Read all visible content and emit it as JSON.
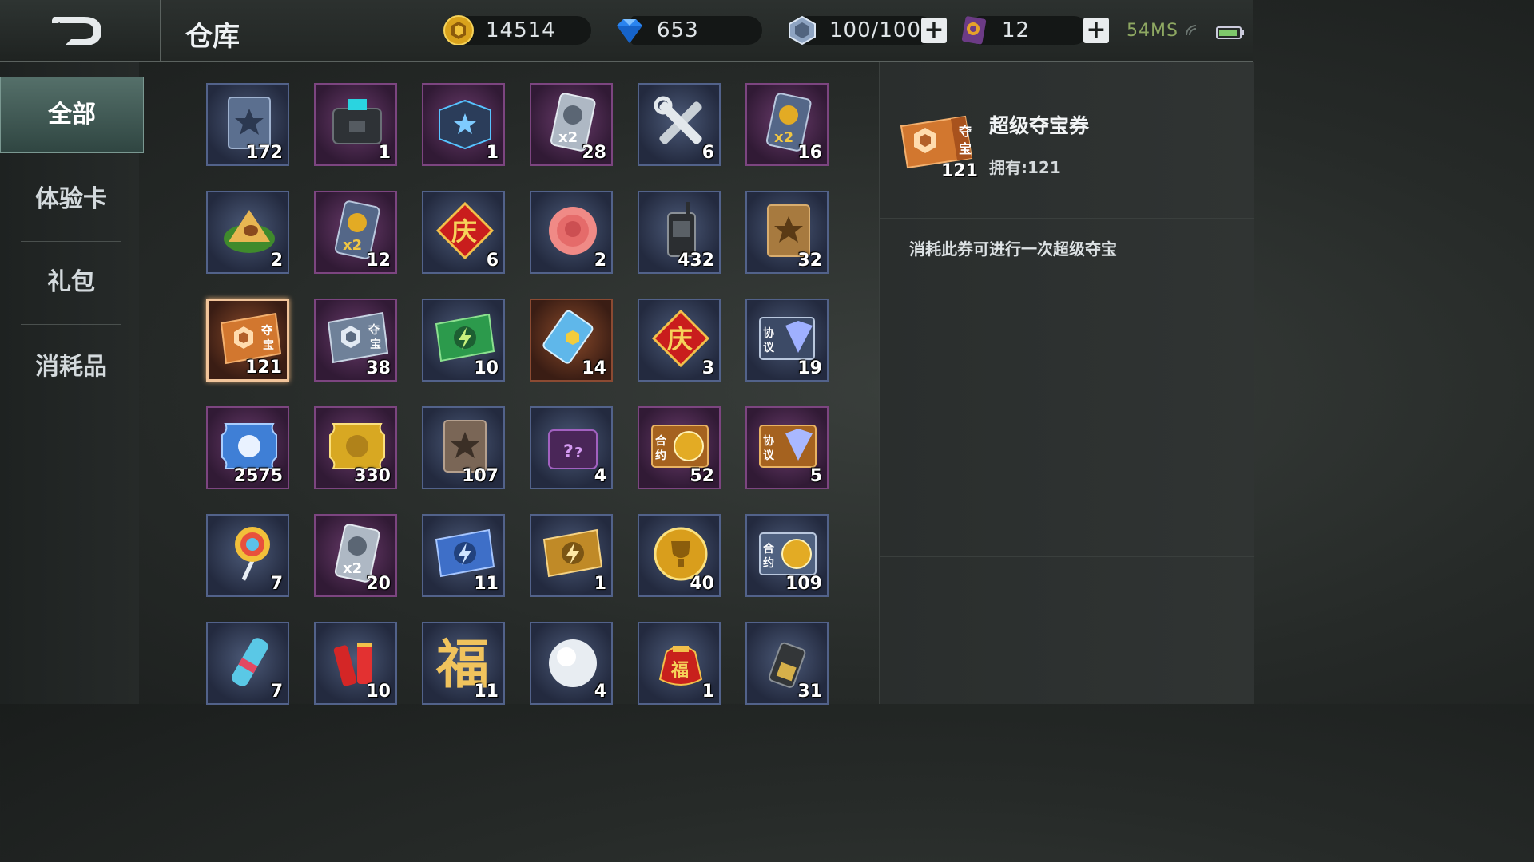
{
  "header": {
    "title": "仓库",
    "gold": "14514",
    "diamond": "653",
    "energy": "100/100",
    "ticket": "12",
    "network": "54MS",
    "plus": "+"
  },
  "sidebar": {
    "tabs": [
      {
        "label": "全部",
        "active": true
      },
      {
        "label": "体验卡",
        "active": false
      },
      {
        "label": "礼包",
        "active": false
      },
      {
        "label": "消耗品",
        "active": false
      }
    ]
  },
  "inventory": [
    {
      "name": "blue-book-icon",
      "qty": "172",
      "frame": "blue"
    },
    {
      "name": "black-chest-icon",
      "qty": "1",
      "frame": "purple"
    },
    {
      "name": "blue-box-icon",
      "qty": "1",
      "frame": "purple"
    },
    {
      "name": "silver-x2-card-icon",
      "qty": "28",
      "frame": "purple"
    },
    {
      "name": "wrench-tools-icon",
      "qty": "6",
      "frame": "blue"
    },
    {
      "name": "gold-x2-card-icon",
      "qty": "16",
      "frame": "purple"
    },
    {
      "name": "rice-dumpling-icon",
      "qty": "2",
      "frame": "blue"
    },
    {
      "name": "gold-x2-card-icon",
      "qty": "12",
      "frame": "purple"
    },
    {
      "name": "celebration-tile-icon",
      "qty": "6",
      "frame": "blue"
    },
    {
      "name": "rose-icon",
      "qty": "2",
      "frame": "blue"
    },
    {
      "name": "walkie-talkie-icon",
      "qty": "432",
      "frame": "blue"
    },
    {
      "name": "bronze-book-icon",
      "qty": "32",
      "frame": "blue"
    },
    {
      "name": "super-treasure-ticket-icon",
      "qty": "121",
      "frame": "orange",
      "selected": true
    },
    {
      "name": "silver-treasure-ticket-icon",
      "qty": "38",
      "frame": "purple"
    },
    {
      "name": "green-lightning-card-icon",
      "qty": "10",
      "frame": "blue"
    },
    {
      "name": "blue-chip-card-icon",
      "qty": "14",
      "frame": "orange"
    },
    {
      "name": "celebration-tile-icon",
      "qty": "3",
      "frame": "blue"
    },
    {
      "name": "diamond-agreement-icon",
      "qty": "19",
      "frame": "blue"
    },
    {
      "name": "blue-coupon-icon",
      "qty": "2575",
      "frame": "purple"
    },
    {
      "name": "gold-coupon-icon",
      "qty": "330",
      "frame": "purple"
    },
    {
      "name": "brown-book-icon",
      "qty": "107",
      "frame": "blue"
    },
    {
      "name": "purple-mystery-chest-icon",
      "qty": "4",
      "frame": "blue"
    },
    {
      "name": "gold-contract-card-icon",
      "qty": "52",
      "frame": "purple"
    },
    {
      "name": "gold-diamond-agreement-icon",
      "qty": "5",
      "frame": "purple"
    },
    {
      "name": "lollipop-icon",
      "qty": "7",
      "frame": "blue"
    },
    {
      "name": "silver-x2-card-icon",
      "qty": "20",
      "frame": "purple"
    },
    {
      "name": "blue-lightning-card-icon",
      "qty": "11",
      "frame": "blue"
    },
    {
      "name": "gold-lightning-card-icon",
      "qty": "1",
      "frame": "blue"
    },
    {
      "name": "gold-trophy-coin-icon",
      "qty": "40",
      "frame": "blue"
    },
    {
      "name": "contract-card-icon",
      "qty": "109",
      "frame": "blue"
    },
    {
      "name": "spray-canister-icon",
      "qty": "7",
      "frame": "blue"
    },
    {
      "name": "firecracker-icon",
      "qty": "10",
      "frame": "blue"
    },
    {
      "name": "fortune-character-icon",
      "qty": "11",
      "frame": "blue"
    },
    {
      "name": "snowball-icon",
      "qty": "4",
      "frame": "blue"
    },
    {
      "name": "lucky-bag-icon",
      "qty": "1",
      "frame": "blue"
    },
    {
      "name": "gold-walkie-talkie-icon",
      "qty": "31",
      "frame": "blue"
    }
  ],
  "detail": {
    "name": "超级夺宝券",
    "qty": "121",
    "owned": "拥有:121",
    "description": "消耗此券可进行一次超级夺宝"
  }
}
